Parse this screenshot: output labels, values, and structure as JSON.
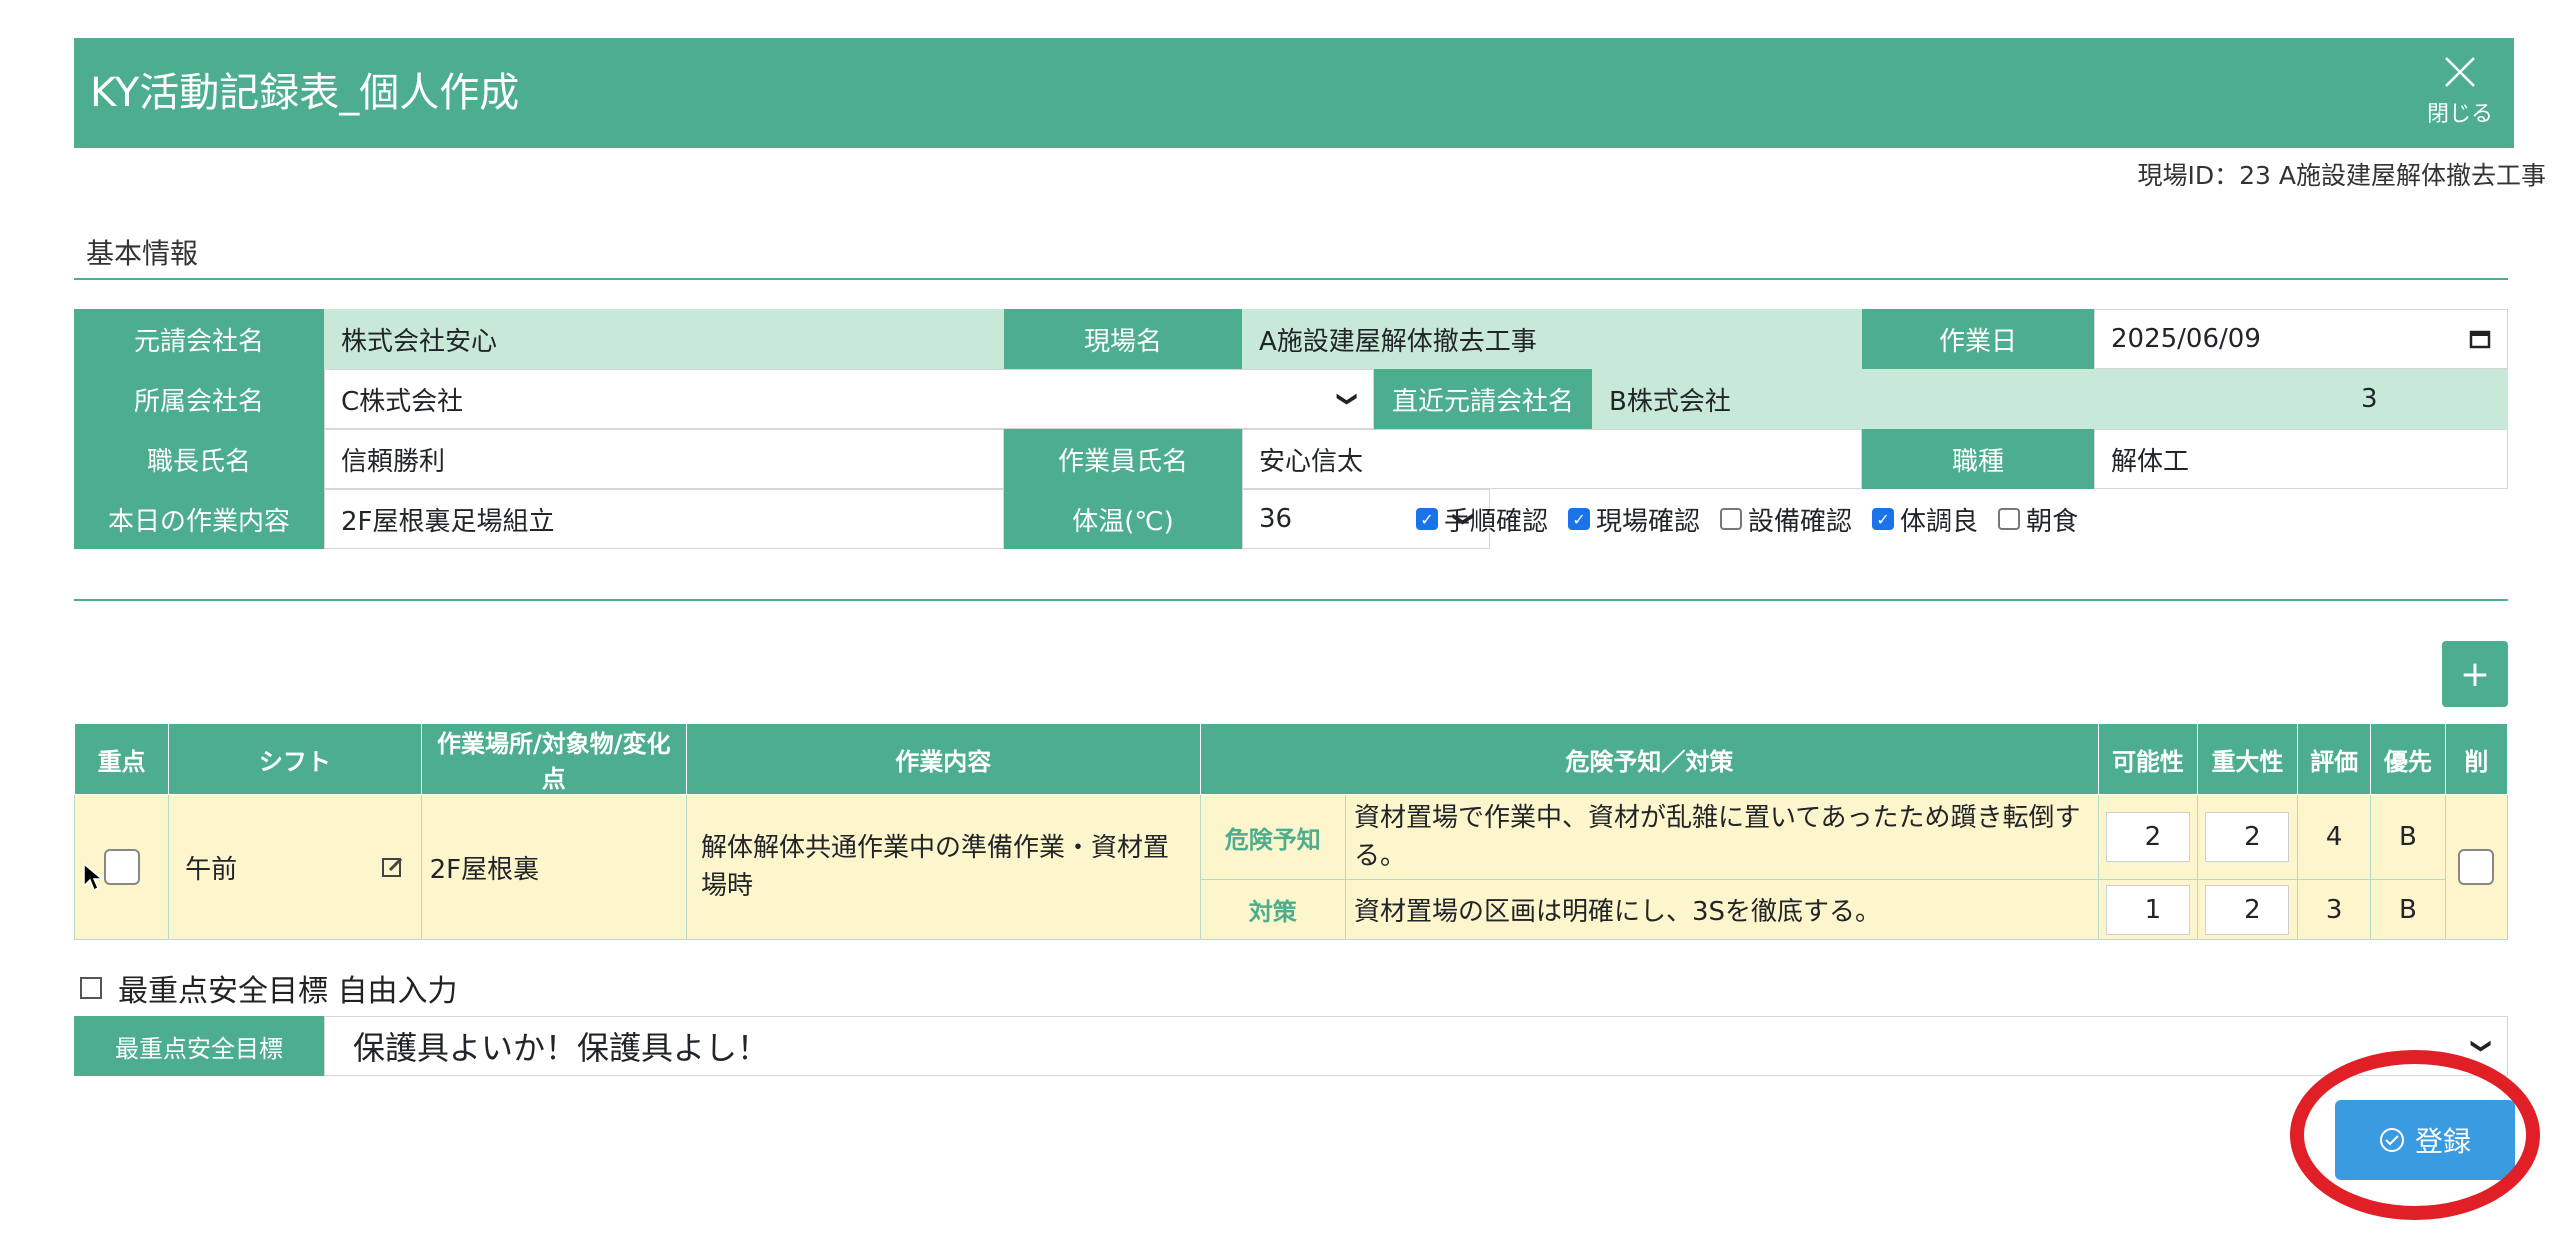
{
  "header": {
    "title": "KY活動記録表_個人作成",
    "close_label": "閉じる"
  },
  "site_id": "現場ID：23 A施設建屋解体撤去工事",
  "basic": {
    "section_title": "基本情報",
    "prime_company_label": "元請会社名",
    "prime_company": "株式会社安心",
    "site_name_label": "現場名",
    "site_name": "A施設建屋解体撤去工事",
    "work_date_label": "作業日",
    "work_date": "2025/06/09",
    "affiliation_label": "所属会社名",
    "affiliation": "C株式会社",
    "direct_prime_label": "直近元請会社名",
    "direct_prime": "B株式会社",
    "direct_prime_no": "3",
    "foreman_label": "職長氏名",
    "foreman": "信頼勝利",
    "worker_label": "作業員氏名",
    "worker": "安心信太",
    "trade_label": "職種",
    "trade": "解体工",
    "today_work_label": "本日の作業内容",
    "today_work": "2F屋根裏足場組立",
    "temp_label": "体温(℃)",
    "temp": "36",
    "checks": [
      {
        "label": "手順確認",
        "checked": true
      },
      {
        "label": "現場確認",
        "checked": true
      },
      {
        "label": "設備確認",
        "checked": false
      },
      {
        "label": "体調良",
        "checked": true
      },
      {
        "label": "朝食",
        "checked": false
      }
    ]
  },
  "add_button": "+",
  "table": {
    "headers": [
      "重点",
      "シフト",
      "作業場所/対象物/変化点",
      "作業内容",
      "危険予知／対策",
      "可能性",
      "重大性",
      "評価",
      "優先",
      "削"
    ],
    "row": {
      "shift": "午前",
      "place": "2F屋根裏",
      "content": "解体解体共通作業中の準備作業・資材置場時",
      "hazard_kind": "危険予知",
      "hazard_text": "資材置場で作業中、資材が乱雑に置いてあったため躓き転倒する。",
      "hazard_possibility": "2",
      "hazard_severity": "2",
      "hazard_eval": "4",
      "hazard_priority": "B",
      "measure_kind": "対策",
      "measure_text": "資材置場の区画は明確にし、3Sを徹底する。",
      "measure_possibility": "1",
      "measure_severity": "2",
      "measure_eval": "3",
      "measure_priority": "B"
    }
  },
  "free_input_label": "最重点安全目標 自由入力",
  "goal": {
    "label": "最重点安全目標",
    "value": "保護具よいか！保護具よし！"
  },
  "submit_label": "登録",
  "colors": {
    "accent": "#4cae8f",
    "submit": "#3a9be0",
    "highlight_ring": "#e01f26",
    "row_bg": "#fdf6cc"
  }
}
